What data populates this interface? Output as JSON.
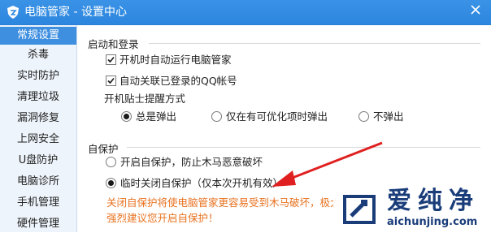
{
  "window": {
    "title": "电脑管家 - 设置中心",
    "accent_color": "#2d86de",
    "icons": {
      "app": "shield-icon",
      "close": "close-icon"
    }
  },
  "sidebar": {
    "items": [
      {
        "label": "常规设置",
        "active": true
      },
      {
        "label": "杀毒",
        "active": false
      },
      {
        "label": "实时防护",
        "active": false
      },
      {
        "label": "清理垃圾",
        "active": false
      },
      {
        "label": "漏洞修复",
        "active": false
      },
      {
        "label": "上网安全",
        "active": false
      },
      {
        "label": "U盘防护",
        "active": false
      },
      {
        "label": "电脑诊所",
        "active": false
      },
      {
        "label": "手机管理",
        "active": false
      },
      {
        "label": "硬件管理",
        "active": false
      }
    ]
  },
  "startup": {
    "title": "启动和登录",
    "auto_run": {
      "label": "开机时自动运行电脑管家",
      "checked": true
    },
    "auto_link_qq": {
      "label": "自动关联已登录的QQ帐号",
      "checked": true
    },
    "tips_title": "开机贴士提醒方式",
    "tips_options": [
      {
        "label": "总是弹出",
        "selected": true
      },
      {
        "label": "仅在有可优化项时弹出",
        "selected": false
      },
      {
        "label": "不弹出",
        "selected": false
      }
    ]
  },
  "self_protect": {
    "title": "自保护",
    "options": [
      {
        "label": "开启自保护，防止木马恶意破坏",
        "selected": false
      },
      {
        "label": "临时关闭自保护（仅本次开机有效）",
        "selected": true
      }
    ],
    "warning": "关闭自保护将使电脑管家更容易受到木马破坏，极大",
    "warning_line2": "强烈建议您开启自保护！",
    "warning_color": "#e8711f"
  },
  "watermark": {
    "text": "爱纯净",
    "domain": "aichunjing.com"
  },
  "annotation": {
    "arrow_color": "#e02020"
  }
}
